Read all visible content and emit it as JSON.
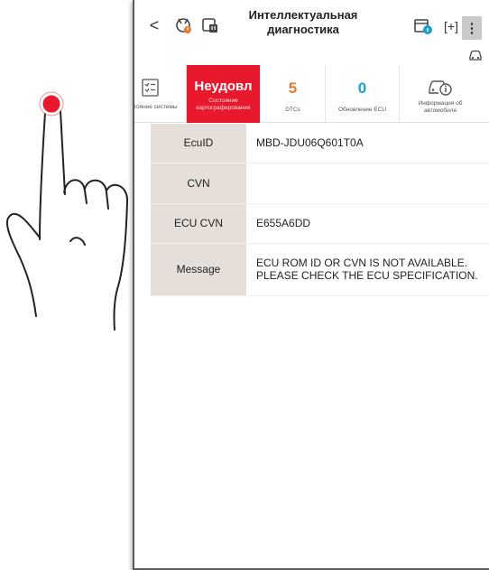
{
  "header": {
    "back_label": "<",
    "title": "Интеллектуальная диагностика",
    "expand_label": "[+]",
    "menu_label": "⋮"
  },
  "tabs": [
    {
      "caption": "Состояние системы",
      "value": ""
    },
    {
      "caption": "Состояние картографирования",
      "value": "Неудовл"
    },
    {
      "caption": "DTCs",
      "value": "5"
    },
    {
      "caption": "Обновление ECU",
      "value": "0"
    },
    {
      "caption": "Информация об автомобиле",
      "value": ""
    }
  ],
  "ecu_details": [
    {
      "key": "EcuID",
      "value": "MBD-JDU06Q601T0A"
    },
    {
      "key": "CVN",
      "value": ""
    },
    {
      "key": "ECU CVN",
      "value": "E655A6DD"
    },
    {
      "key": "Message",
      "value": "ECU ROM ID OR CVN IS NOT AVAILABLE. PLEASE CHECK THE ECU SPECIFICATION."
    }
  ],
  "colors": {
    "accent_red": "#e8192c",
    "dtc_orange": "#e8782a",
    "ecu_blue": "#1a9fcc",
    "key_cell_bg": "#e6ded8",
    "touch_point": "#e8192c"
  }
}
